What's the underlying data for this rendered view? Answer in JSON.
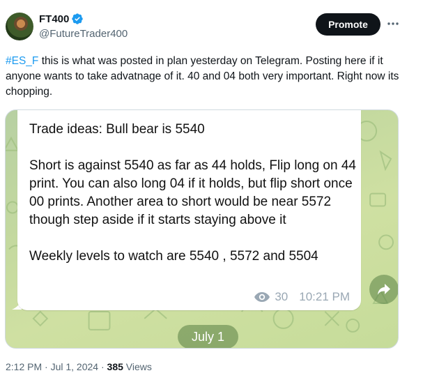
{
  "author": {
    "display_name": "FT400",
    "handle": "@FutureTrader400",
    "verified_icon": "verified-badge-icon"
  },
  "header": {
    "promote_label": "Promote",
    "more_icon": "more-horizontal-icon"
  },
  "tweet": {
    "hashtag": "#ES_F",
    "text": " this is what was posted in plan yesterday on Telegram.  Posting here if it anyone wants to take advatnage of it.  40 and 04 both very important. Right now its chopping."
  },
  "media": {
    "message_lines": [
      "Trade ideas: Bull bear is 5540",
      "Short is against 5540 as far as 44 holds, Flip long on 44 print.  You can also long 04 if it holds, but flip short once 00 prints. Another area to short would be near  5572 though step aside if it starts staying above it",
      "Weekly levels to watch are 5540 , 5572 and 5504"
    ],
    "view_count": "30",
    "time": "10:21 PM",
    "date_pill": "July 1",
    "share_icon": "share-arrow-icon",
    "eye_icon": "eye-icon"
  },
  "footer": {
    "timestamp": "2:12 PM · Jul 1, 2024 · ",
    "views_count": "385",
    "views_label": " Views"
  },
  "colors": {
    "accent": "#1d9bf0",
    "text": "#0f1419",
    "muted": "#536471",
    "button_bg": "#0f1419"
  }
}
